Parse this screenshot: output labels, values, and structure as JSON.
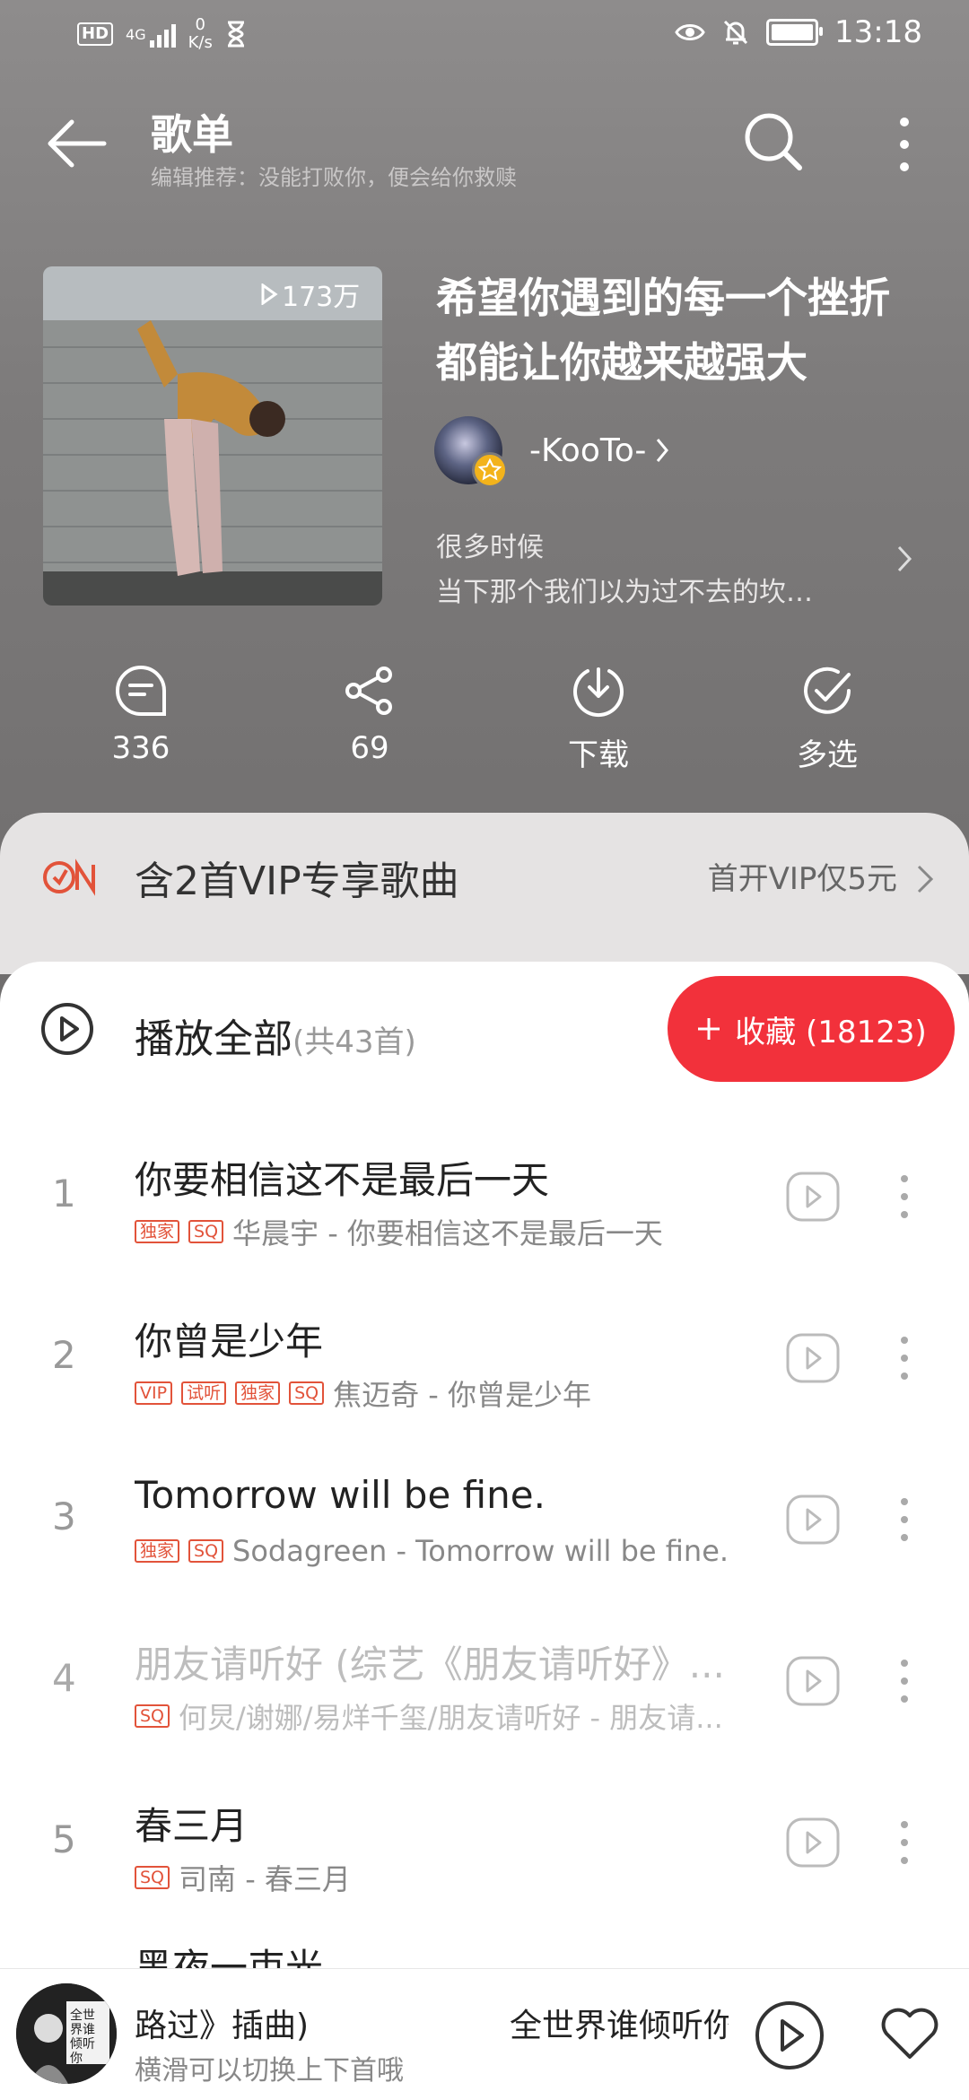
{
  "status_bar": {
    "hd": "HD",
    "network": "4G",
    "speed_value": "0",
    "speed_unit": "K/s",
    "time": "13:18"
  },
  "header": {
    "title": "歌单",
    "subtitle": "编辑推荐：没能打败你，便会给你救赎"
  },
  "playlist": {
    "play_count": "173万",
    "title": "希望你遇到的每一个挫折都能让你越来越强大",
    "creator": "-KooTo-",
    "description_line1": "很多时候",
    "description_line2": "当下那个我们以为过不去的坎…"
  },
  "actions": [
    {
      "icon": "comment-icon",
      "label": "336"
    },
    {
      "icon": "share-icon",
      "label": "69"
    },
    {
      "icon": "download-icon",
      "label": "下载"
    },
    {
      "icon": "multiselect-icon",
      "label": "多选"
    }
  ],
  "vip": {
    "text": "含2首VIP专享歌曲",
    "link": "首开VIP仅5元"
  },
  "play_all": {
    "label": "播放全部",
    "count": "(共43首)",
    "collect_label": "收藏 (18123)"
  },
  "songs": [
    {
      "num": "1",
      "title": "你要相信这不是最后一天",
      "tags": [
        "独家",
        "SQ"
      ],
      "meta": "华晨宇 - 你要相信这不是最后一天"
    },
    {
      "num": "2",
      "title": "你曾是少年",
      "tags": [
        "VIP",
        "试听",
        "独家",
        "SQ"
      ],
      "meta": "焦迈奇 - 你曾是少年"
    },
    {
      "num": "3",
      "title": "Tomorrow will be fine.",
      "tags": [
        "独家",
        "SQ"
      ],
      "meta": "Sodagreen - Tomorrow will be fine."
    },
    {
      "num": "4",
      "title": "朋友请听好 (综艺《朋友请听好》...",
      "tags": [
        "SQ"
      ],
      "meta": "何炅/谢娜/易烊千玺/朋友请听好 - 朋友请..."
    },
    {
      "num": "5",
      "title": "春三月",
      "tags": [
        "SQ"
      ],
      "meta": "司南 - 春三月"
    }
  ],
  "partial_row_title": "黑夜一束光",
  "mini_player": {
    "cover_text": "全世界谁倾听你",
    "song_left": "路过》插曲)",
    "song_right": "全世界谁倾听你",
    "hint": "横滑可以切换上下首哦"
  },
  "colors": {
    "accent_red": "#f2313b",
    "header_gray": "#7d7b7b",
    "tag_red": "#e2533a"
  }
}
